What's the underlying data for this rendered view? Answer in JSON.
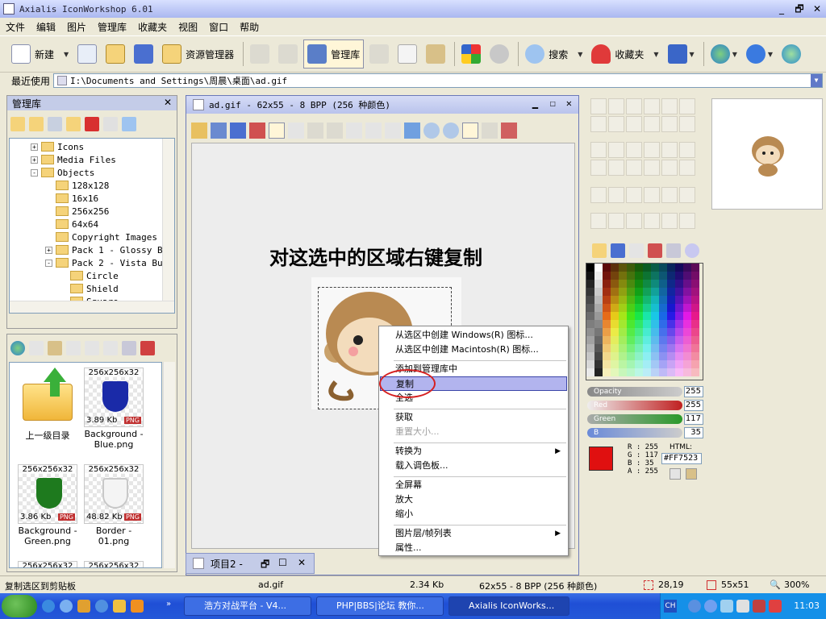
{
  "window": {
    "title": "Axialis IconWorkshop 6.01",
    "min": "_",
    "restore": "🗗",
    "close": "✕"
  },
  "menu": [
    "文件",
    "编辑",
    "图片",
    "管理库",
    "收藏夹",
    "视图",
    "窗口",
    "帮助"
  ],
  "toolbar": {
    "new": "新建",
    "explorer": "资源管理器",
    "library": "管理库",
    "search": "搜索",
    "favorites": "收藏夹"
  },
  "address": {
    "label": "最近使用",
    "path": "I:\\Documents and Settings\\周晨\\桌面\\ad.gif"
  },
  "library_panel": {
    "title": "管理库",
    "tree": [
      {
        "label": "Icons",
        "level": 1,
        "expander": "+"
      },
      {
        "label": "Media Files",
        "level": 1,
        "expander": "+"
      },
      {
        "label": "Objects",
        "level": 1,
        "expander": "-"
      },
      {
        "label": "128x128",
        "level": 2,
        "expander": ""
      },
      {
        "label": "16x16",
        "level": 2,
        "expander": ""
      },
      {
        "label": "256x256",
        "level": 2,
        "expander": ""
      },
      {
        "label": "64x64",
        "level": 2,
        "expander": ""
      },
      {
        "label": "Copyright Images",
        "level": 2,
        "expander": ""
      },
      {
        "label": "Pack 1 - Glossy Bu",
        "level": 2,
        "expander": "+"
      },
      {
        "label": "Pack 2 - Vista But",
        "level": 2,
        "expander": "-"
      },
      {
        "label": "Circle",
        "level": 3,
        "expander": ""
      },
      {
        "label": "Shield",
        "level": 3,
        "expander": ""
      },
      {
        "label": "Square",
        "level": 3,
        "expander": ""
      }
    ]
  },
  "files": [
    {
      "caption": "",
      "size": "",
      "name": "上一级目录",
      "kind": "folder"
    },
    {
      "caption": "256x256x32",
      "size": "3.89 Kb",
      "name": "Background - Blue.png",
      "kind": "shield",
      "color": "#1a2aa8"
    },
    {
      "caption": "256x256x32",
      "size": "3.86 Kb",
      "name": "Background - Green.png",
      "kind": "shield",
      "color": "#1e7a1e"
    },
    {
      "caption": "256x256x32",
      "size": "48.82 Kb",
      "name": "Border - 01.png",
      "kind": "shield",
      "color": "#e8e8e8"
    },
    {
      "caption": "256x256x32",
      "size": "",
      "name": "",
      "kind": "partial"
    },
    {
      "caption": "256x256x32",
      "size": "",
      "name": "",
      "kind": "partial"
    }
  ],
  "png_badge": "PNG",
  "document": {
    "title": "ad.gif - 62x55 - 8 BPP (256 种颜色)",
    "overlay_text": "对这选中的区域右键复制",
    "tab": "项目2 -"
  },
  "context_menu": {
    "items": [
      {
        "label": "从选区中创建 Windows(R) 图标...",
        "state": "normal",
        "sub": ""
      },
      {
        "label": "从选区中创建 Macintosh(R) 图标...",
        "state": "normal",
        "sub": ""
      },
      {
        "label": "添加到管理库中",
        "state": "normal",
        "sub": ""
      },
      {
        "label": "复制",
        "state": "highlight",
        "sub": ""
      },
      {
        "label": "全选",
        "state": "normal",
        "sub": ""
      },
      {
        "label": "获取",
        "state": "normal",
        "sub": ""
      },
      {
        "label": "重置大小...",
        "state": "disabled",
        "sub": ""
      },
      {
        "label": "转换为",
        "state": "normal",
        "sub": "▶"
      },
      {
        "label": "载入调色板...",
        "state": "normal",
        "sub": ""
      },
      {
        "label": "全屏幕",
        "state": "normal",
        "sub": ""
      },
      {
        "label": "放大",
        "state": "normal",
        "sub": ""
      },
      {
        "label": "缩小",
        "state": "normal",
        "sub": ""
      },
      {
        "label": "图片层/帧列表",
        "state": "normal",
        "sub": "▶"
      },
      {
        "label": "属性...",
        "state": "normal",
        "sub": ""
      }
    ]
  },
  "color_panel": {
    "opacity_label": "Opacity",
    "opacity_value": "255",
    "red_label": "Red",
    "red_value": "255",
    "green_label": "Green",
    "green_value": "117",
    "blue_label": "B",
    "blue_value": "35",
    "r_line": "R : 255",
    "g_line": "G : 117",
    "b_line": "B :  35",
    "a_line": "A : 255",
    "html_label": "HTML:",
    "html_value": "#FF7523",
    "primary": "#e01010",
    "secondary": "#ff7523"
  },
  "status": {
    "hint": "复制选区到剪贴板",
    "file": "ad.gif",
    "size": "2.34 Kb",
    "format": "62x55 - 8 BPP (256 种颜色)",
    "cursor": "28,19",
    "selection": "55x51",
    "zoom": "300%"
  },
  "taskbar": {
    "tasks": [
      "浩方对战平台 - V4...",
      "PHP|BBS|论坛 教你...",
      "Axialis IconWorks..."
    ],
    "lang": "CH",
    "clock": "11:03"
  }
}
